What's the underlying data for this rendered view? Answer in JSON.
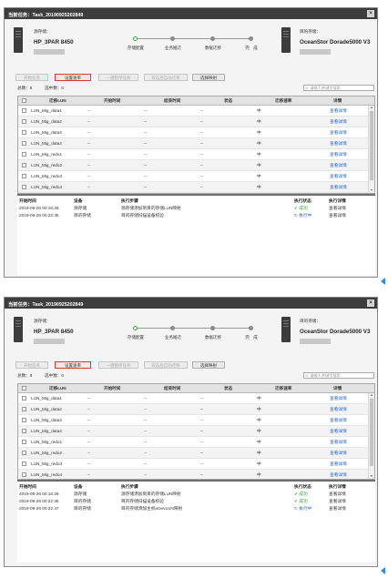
{
  "dialog_title": "当前任务：Task_20190925202849",
  "close_glyph": "×",
  "source": {
    "label": "源存储：",
    "name": "HP_3PAR 8450"
  },
  "target": {
    "label": "目的存储：",
    "name": "OceanStor Dorade5000 V3"
  },
  "steps": [
    "存储配置",
    "业务搬迁",
    "数据迁移",
    "完　成"
  ],
  "buttons": {
    "start": "开始任务",
    "set_rate": "设置速率",
    "stop": "一键暂停任务",
    "cleanup": "双击后自动迁移",
    "select_map": "选择映射"
  },
  "total": "总数：8",
  "selected": "选中数：0",
  "search_placeholder": "请输入关键字搜索",
  "columns": [
    "迁移LUN",
    "开始时间",
    "结束时间",
    "状态",
    "迁移速率",
    "详情"
  ],
  "rows": [
    {
      "name": "LUN_Mig_data1",
      "start": "--",
      "end": "--",
      "status": "--",
      "rate": "中",
      "detail": "查看详情"
    },
    {
      "name": "LUN_Mig_data2",
      "start": "--",
      "end": "--",
      "status": "--",
      "rate": "中",
      "detail": "查看详情"
    },
    {
      "name": "LUN_Mig_data3",
      "start": "--",
      "end": "--",
      "status": "--",
      "rate": "中",
      "detail": "查看详情"
    },
    {
      "name": "LUN_Mig_data4",
      "start": "--",
      "end": "--",
      "status": "--",
      "rate": "中",
      "detail": "查看详情"
    },
    {
      "name": "LUN_Mig_redo1",
      "start": "--",
      "end": "--",
      "status": "--",
      "rate": "中",
      "detail": "查看详情"
    },
    {
      "name": "LUN_Mig_redo2",
      "start": "--",
      "end": "--",
      "status": "--",
      "rate": "中",
      "detail": "查看详情"
    },
    {
      "name": "LUN_Mig_redo3",
      "start": "--",
      "end": "--",
      "status": "--",
      "rate": "中",
      "detail": "查看详情"
    },
    {
      "name": "LUN_Mig_redo4",
      "start": "--",
      "end": "--",
      "status": "--",
      "rate": "中",
      "detail": "查看详情"
    }
  ],
  "log_columns": [
    "开始时间",
    "设备",
    "执行步骤",
    "执行状态",
    "执行详情"
  ],
  "log1": [
    {
      "time": "2019-09-26 00:16:28",
      "device": "源存储",
      "step": "源存储添加到目的存储LUN映射",
      "status": "成功",
      "detail": "查看详情"
    },
    {
      "time": "2019-09-26 00:22:35",
      "device": "目的存储",
      "step": "目的存储扫描设备校验",
      "status": "执行中",
      "detail": "查看详情"
    }
  ],
  "log2": [
    {
      "time": "2019-09-26 00:16:28",
      "device": "源存储",
      "step": "源存储添加到目的存储LUN映射",
      "status": "成功",
      "detail": "查看详情"
    },
    {
      "time": "2019-09-26 00:22:35",
      "device": "目的存储",
      "step": "目的存储扫描设备校验",
      "status": "成功",
      "detail": "查看详情"
    },
    {
      "time": "2019-09-26 00:22:47",
      "device": "目的存储",
      "step": "目的存储添加主机eDevLUN映射",
      "status": "执行中",
      "detail": "查看详情"
    }
  ],
  "colors": {
    "titlebar": "#3d3d3d",
    "success": "#2b9a2b",
    "link": "#2a64c8",
    "highlight": "#d23a3a",
    "marker": "#2e8ae6"
  }
}
